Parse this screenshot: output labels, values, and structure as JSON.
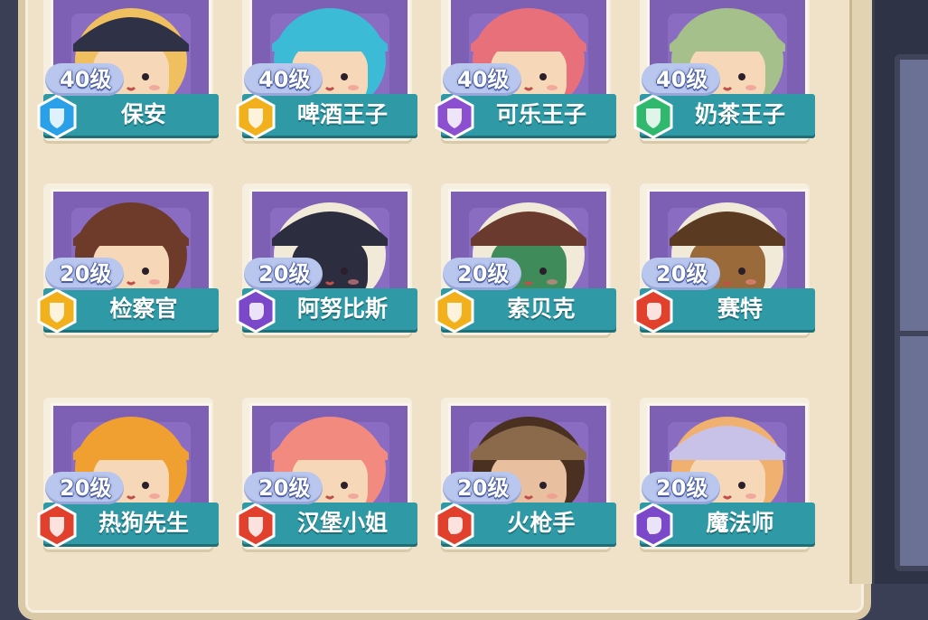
{
  "cards": [
    {
      "level": "40级",
      "name": "保安",
      "badge": "blue-shield",
      "colors": {
        "hat": "#2f3247",
        "hair": "#f0c060",
        "skin": "#f6d8b8"
      }
    },
    {
      "level": "40级",
      "name": "啤酒王子",
      "badge": "gold-shield",
      "colors": {
        "hat": "#3bbbd6",
        "hair": "#3bbbd6",
        "skin": "#f6d8b8"
      }
    },
    {
      "level": "40级",
      "name": "可乐王子",
      "badge": "purple-shield",
      "colors": {
        "hat": "#e8707a",
        "hair": "#e8707a",
        "skin": "#f6d8b8"
      }
    },
    {
      "level": "40级",
      "name": "奶茶王子",
      "badge": "green-shield",
      "colors": {
        "hat": "#a5c08a",
        "hair": "#a5c08a",
        "skin": "#f6d8b8"
      }
    },
    {
      "level": "20级",
      "name": "检察官",
      "badge": "gold-shield",
      "colors": {
        "hat": "#6e3a2a",
        "hair": "#6e3a2a",
        "skin": "#f6d8b8"
      }
    },
    {
      "level": "20级",
      "name": "阿努比斯",
      "badge": "purple-fist",
      "colors": {
        "hat": "#2c2d3f",
        "hair": "#f2ead8",
        "skin": "#2c2d3f"
      }
    },
    {
      "level": "20级",
      "name": "索贝克",
      "badge": "gold-shield",
      "colors": {
        "hat": "#6a3a2e",
        "hair": "#f2ead8",
        "skin": "#3f8b5a"
      }
    },
    {
      "level": "20级",
      "name": "赛特",
      "badge": "red-fist",
      "colors": {
        "hat": "#5a3a20",
        "hair": "#f2ead8",
        "skin": "#9a6a3a"
      }
    },
    {
      "level": "20级",
      "name": "热狗先生",
      "badge": "red-shield",
      "colors": {
        "hat": "#f0a030",
        "hair": "#f0a030",
        "skin": "#f6d8b8"
      }
    },
    {
      "level": "20级",
      "name": "汉堡小姐",
      "badge": "red-shield",
      "colors": {
        "hat": "#f28a80",
        "hair": "#f28a80",
        "skin": "#f6d8b8"
      }
    },
    {
      "level": "20级",
      "name": "火枪手",
      "badge": "red-fist",
      "colors": {
        "hat": "#8a6a4a",
        "hair": "#4a3020",
        "skin": "#e8c0a0"
      }
    },
    {
      "level": "20级",
      "name": "魔法师",
      "badge": "purple-fist",
      "colors": {
        "hat": "#c9c2e8",
        "hair": "#f0b070",
        "skin": "#f6d8b8"
      }
    }
  ],
  "badge_colors": {
    "blue-shield": "#2aa0e8",
    "gold-shield": "#f2b01c",
    "purple-shield": "#8b4fd0",
    "green-shield": "#2fb86e",
    "purple-fist": "#7a48c8",
    "red-fist": "#e0402c",
    "red-shield": "#e0402c"
  }
}
